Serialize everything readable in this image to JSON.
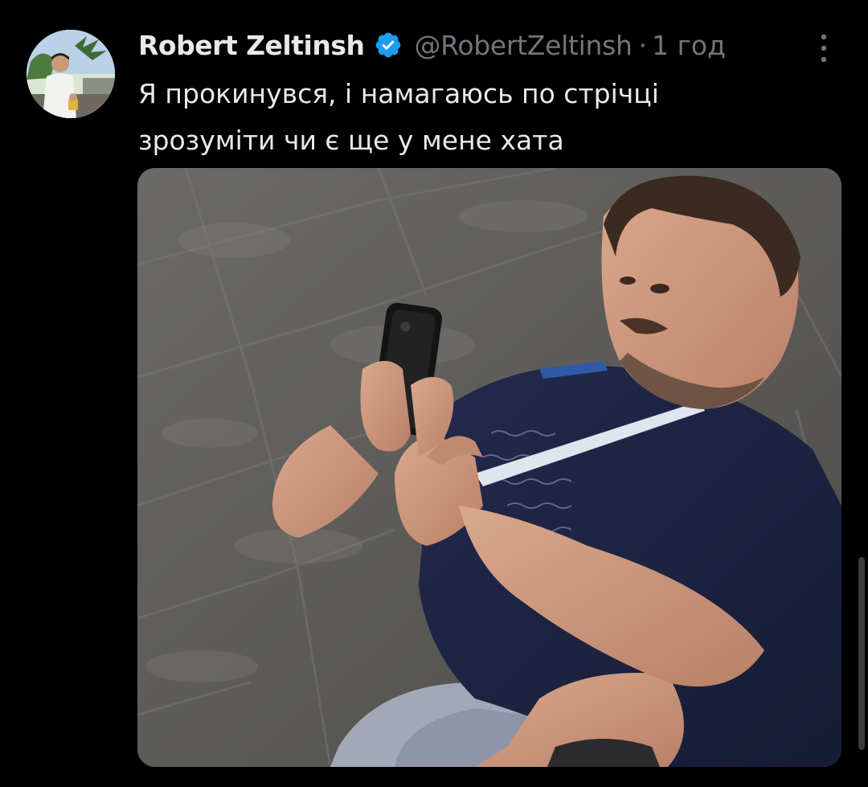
{
  "tweet": {
    "author_name": "Robert Zeltinsh",
    "handle": "@RobertZeltinsh",
    "separator": "·",
    "time": "1 год",
    "text_lines": [
      "Я прокинувся, і намагаюсь по стрічці",
      "зрозуміти чи є ще у мене хата"
    ]
  },
  "icons": {
    "verified": "verified-badge-icon",
    "more": "more-vertical-icon"
  },
  "colors": {
    "background": "#000000",
    "primary_text": "#e7e9ea",
    "secondary_text": "#71767b",
    "verified": "#1d9bf0"
  }
}
